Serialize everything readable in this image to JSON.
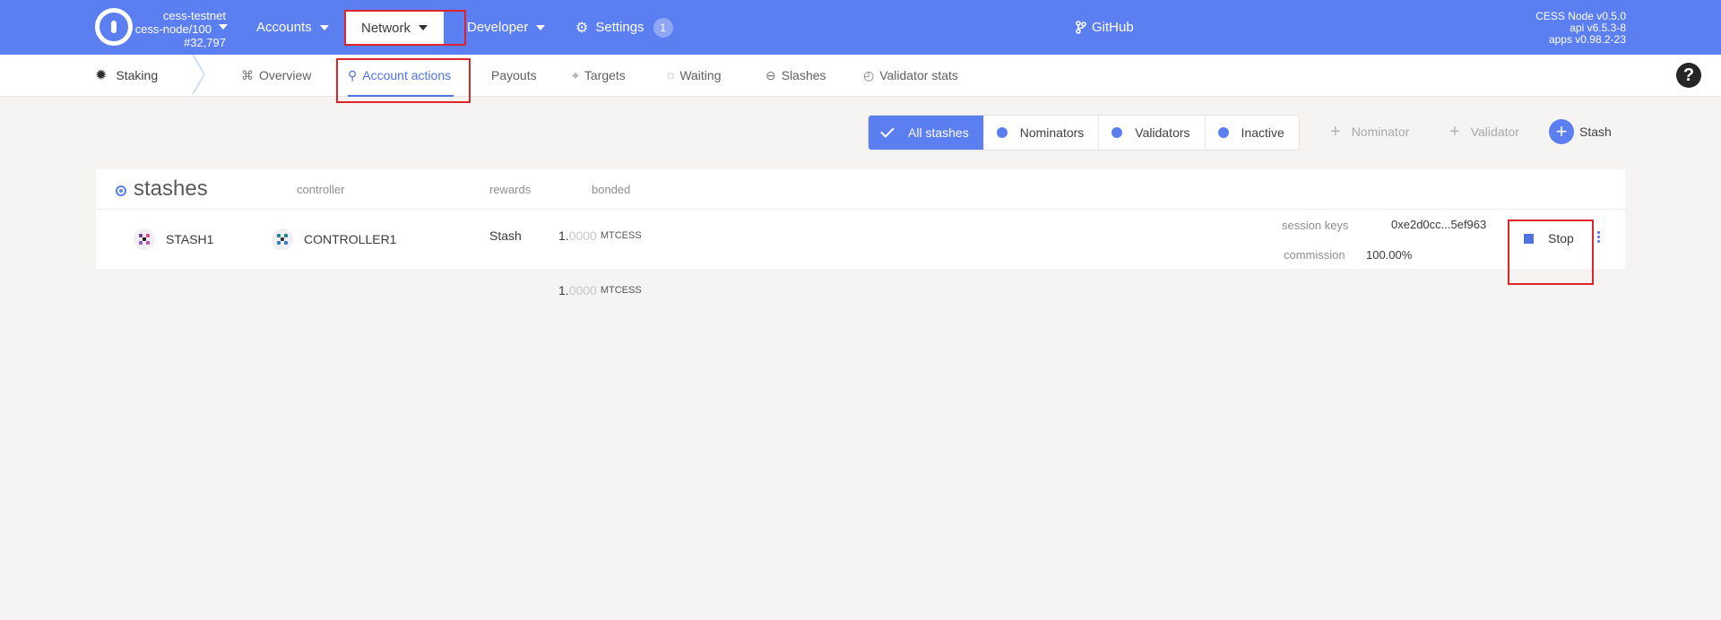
{
  "topbar": {
    "chain_name": "cess-testnet",
    "node_name": "cess-node/100",
    "block": "#32,797",
    "menu": {
      "accounts": "Accounts",
      "network": "Network",
      "developer": "Developer",
      "settings": "Settings",
      "settings_badge": "1"
    },
    "github": "GitHub",
    "version": {
      "node": "CESS Node v0.5.0",
      "api": "api v6.5.3-8",
      "apps": "apps v0.98.2-23"
    }
  },
  "tabs": {
    "section": "Staking",
    "items": [
      "Overview",
      "Account actions",
      "Payouts",
      "Targets",
      "Waiting",
      "Slashes",
      "Validator stats"
    ],
    "active": "Account actions"
  },
  "filters": {
    "toggles": [
      "All stashes",
      "Nominators",
      "Validators",
      "Inactive"
    ],
    "selected": "All stashes",
    "add_nominator": "Nominator",
    "add_validator": "Validator",
    "add_stash": "Stash"
  },
  "table": {
    "title": "stashes",
    "headers": {
      "controller": "controller",
      "rewards": "rewards",
      "bonded": "bonded"
    },
    "rows": [
      {
        "stash": "STASH1",
        "controller": "CONTROLLER1",
        "rewards": "Stash",
        "bonded_int": "1.",
        "bonded_frac": "0000",
        "bonded_unit": "MTCESS",
        "session_keys_label": "session keys",
        "session_keys": "0xe2d0cc...5ef963",
        "commission_label": "commission",
        "commission": "100.00%",
        "stop_label": "Stop"
      }
    ],
    "total": {
      "int": "1.",
      "frac": "0000",
      "unit": "MTCESS"
    }
  },
  "colors": {
    "accent": "#5b7ef0",
    "highlight_box": "#e0242a"
  }
}
